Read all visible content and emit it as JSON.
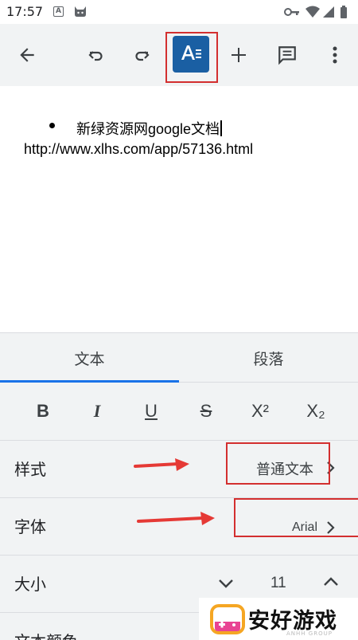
{
  "status_bar": {
    "time": "17:57",
    "notification_letter": "A"
  },
  "toolbar": {
    "icons": [
      "back-arrow-icon",
      "undo-icon",
      "redo-icon",
      "text-format-icon",
      "add-icon",
      "comment-icon",
      "more-vert-icon"
    ],
    "colors": {
      "format_button_bg": "#1a5fa3",
      "highlight_box": "#d32f2f"
    }
  },
  "document": {
    "bullet_text": "新绿资源网google文档",
    "url_line": "http://www.xlhs.com/app/57136.html"
  },
  "format_panel": {
    "tabs": [
      {
        "label": "文本",
        "selected": true
      },
      {
        "label": "段落",
        "selected": false
      }
    ],
    "text_buttons": {
      "bold": "B",
      "italic": "I",
      "underline": "U",
      "strikethrough": "S",
      "superscript": "X²",
      "subscript": "X₂"
    },
    "rows": {
      "style": {
        "label": "样式",
        "value": "普通文本"
      },
      "font": {
        "label": "字体",
        "value": "Arial"
      },
      "size": {
        "label": "大小",
        "value": "11"
      },
      "text_color": {
        "label": "文本颜色"
      }
    },
    "accent_color": "#1a73e8",
    "annotation_color": "#e53935"
  },
  "watermark": {
    "text": "安好游戏",
    "sub": "ANHH GROUP"
  }
}
